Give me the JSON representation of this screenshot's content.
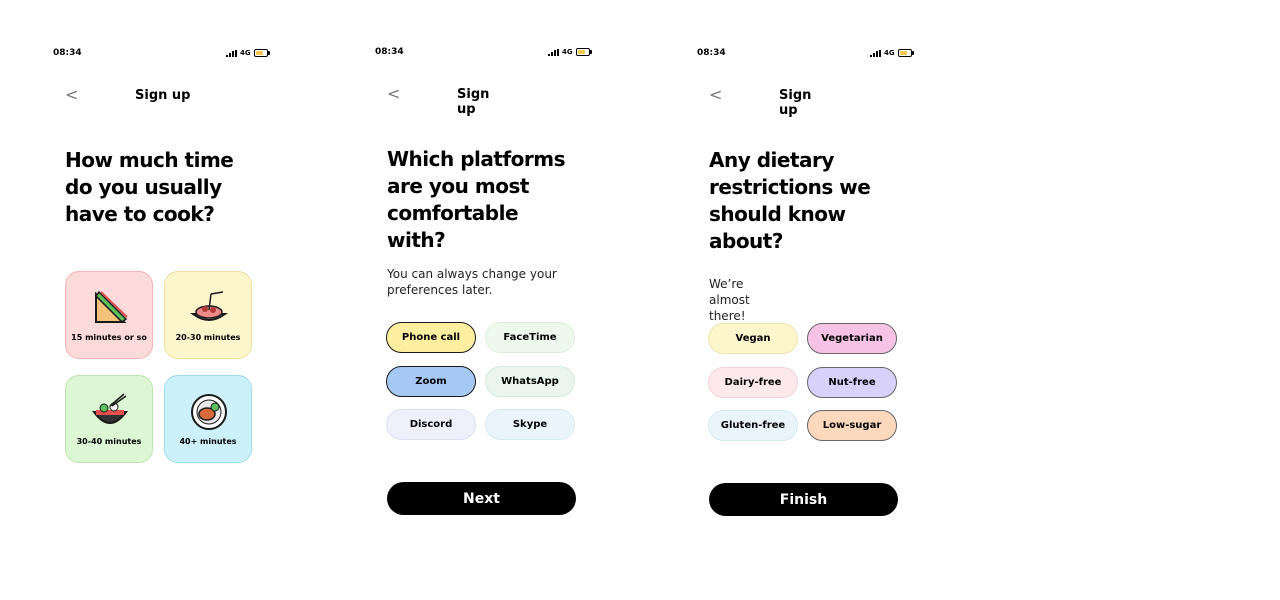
{
  "status": {
    "time": "08:34",
    "network": "4G"
  },
  "screen1": {
    "title": "Sign up",
    "heading": "How much time do you usually have to cook?",
    "options": [
      {
        "label": "15 minutes or so",
        "icon": "sandwich-icon"
      },
      {
        "label": "20-30 minutes",
        "icon": "spaghetti-icon"
      },
      {
        "label": "30-40 minutes",
        "icon": "noodle-bowl-icon"
      },
      {
        "label": "40+ minutes",
        "icon": "steak-plate-icon"
      }
    ]
  },
  "screen2": {
    "title": "Sign up",
    "heading": "Which platforms are you most comfortable with?",
    "subtext": "You can always change your preferences later.",
    "options": [
      "Phone call",
      "FaceTime",
      "Zoom",
      "WhatsApp",
      "Discord",
      "Skype"
    ],
    "button": "Next"
  },
  "screen3": {
    "title": "Sign up",
    "heading": "Any dietary restrictions we should know about?",
    "subtext": "We’re almost there!",
    "options": [
      "Vegan",
      "Vegetarian",
      "Dairy-free",
      "Nut-free",
      "Gluten-free",
      "Low-sugar"
    ],
    "button": "Finish"
  },
  "colors": {
    "tile_pink": "#fcdada",
    "tile_yellow": "#fdf6cc",
    "tile_green": "#dcf7d4",
    "tile_blue": "#cdf1fb",
    "selected_yellow": "#fdeea0",
    "selected_blue": "#a5c8f5",
    "pink_selected": "#f7c3e5",
    "purple_selected": "#d8d1fc",
    "peach_selected": "#fcd9bd"
  }
}
